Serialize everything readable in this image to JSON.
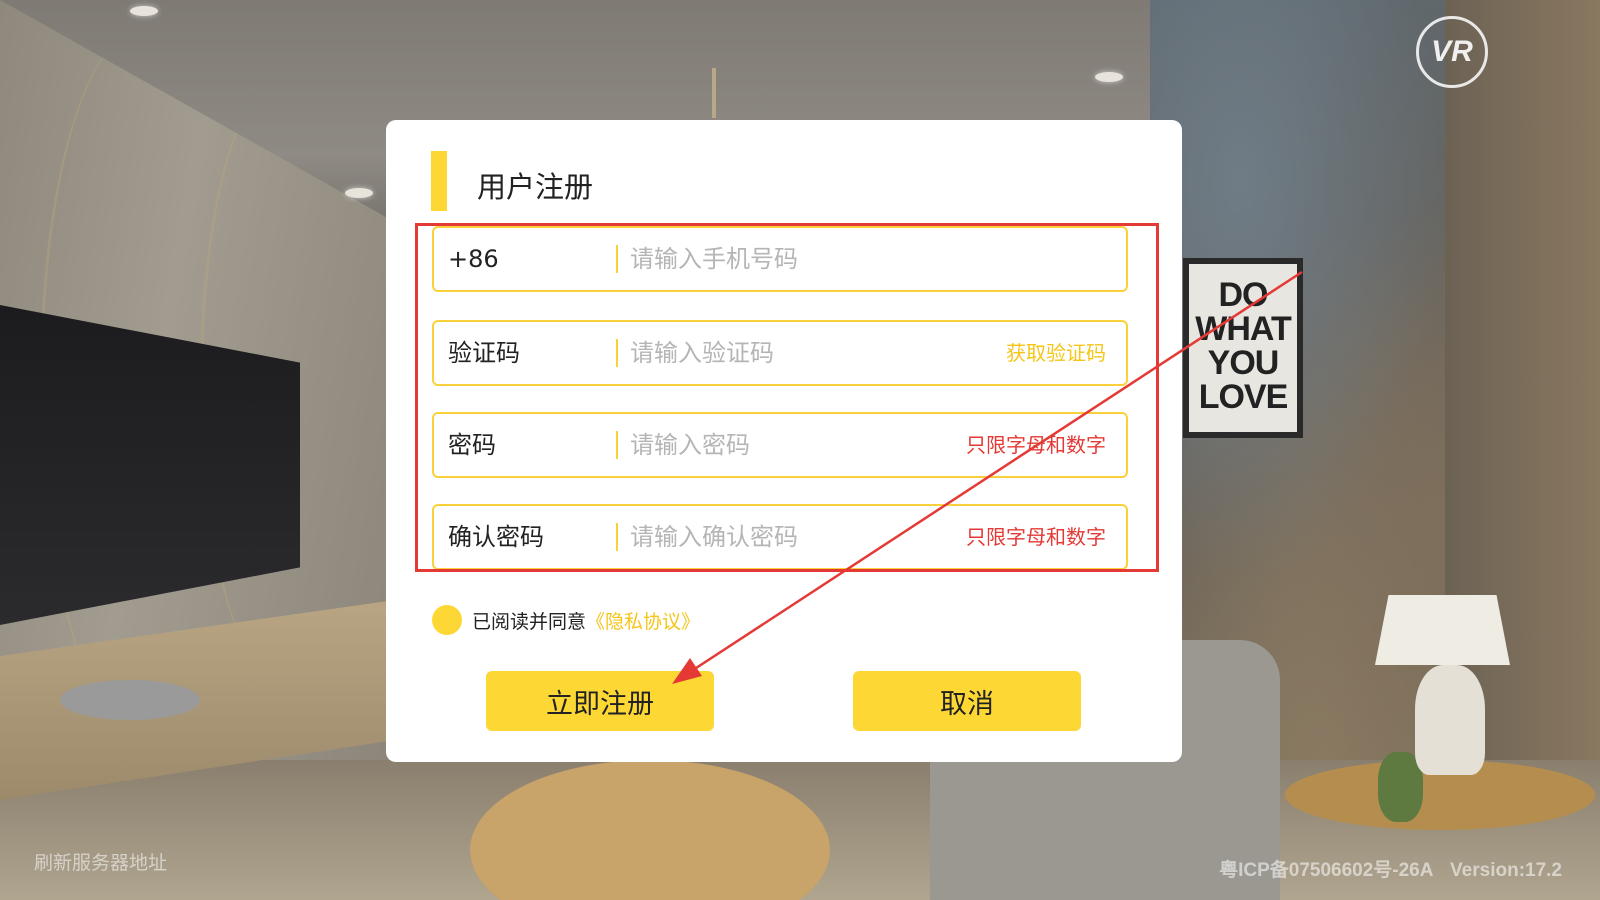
{
  "dialog": {
    "title": "用户注册",
    "fields": [
      {
        "label": "+86",
        "placeholder": "请输入手机号码",
        "value": "",
        "hint": ""
      },
      {
        "label": "验证码",
        "placeholder": "请输入验证码",
        "value": "",
        "hint": "获取验证码"
      },
      {
        "label": "密码",
        "placeholder": "请输入密码",
        "value": "",
        "hint": "只限字母和数字"
      },
      {
        "label": "确认密码",
        "placeholder": "请输入确认密码",
        "value": "",
        "hint": "只限字母和数字"
      }
    ],
    "agreement": {
      "text": "已阅读并同意",
      "link": "《隐私协议》"
    },
    "buttons": {
      "register": "立即注册",
      "cancel": "取消"
    }
  },
  "vr_badge": "VR",
  "poster_text": "DO WHAT YOU LOVE",
  "footer": {
    "refresh": "刷新服务器地址",
    "icp": "粤ICP备07506602号-26A",
    "version": "Version:17.2"
  },
  "colors": {
    "accent": "#fdd835",
    "hint_yellow": "#f5c518",
    "hint_red": "#e53935",
    "annotation": "#e53935"
  },
  "icons": [
    "vr-icon",
    "agree-checkbox-icon"
  ]
}
